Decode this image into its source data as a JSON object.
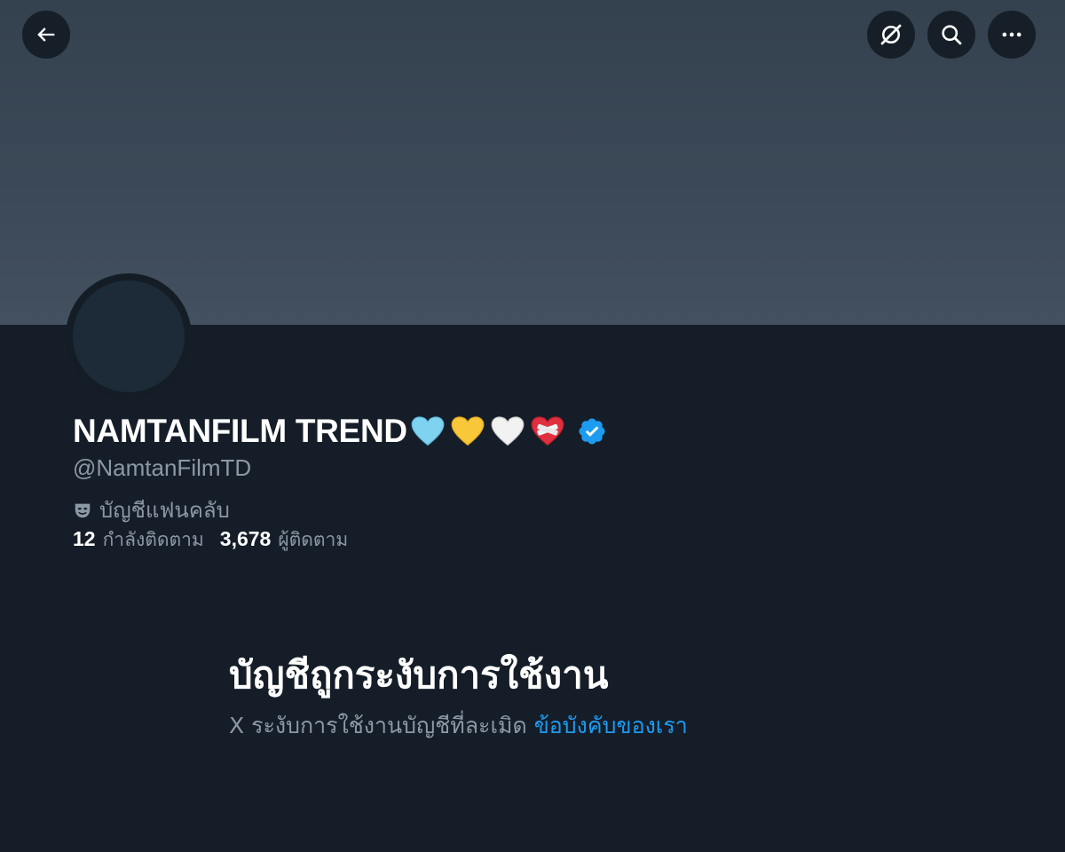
{
  "header": {
    "back_icon": "arrow-left-icon",
    "grok_icon": "grok-icon",
    "search_icon": "search-icon",
    "more_icon": "more-horizontal-icon"
  },
  "profile": {
    "display_name": "NAMTANFILM TREND",
    "name_emojis": [
      "light-blue-heart",
      "yellow-heart",
      "white-heart",
      "mending-heart"
    ],
    "verified_icon": "verified-badge-icon",
    "verified_color": "#1d9bf0",
    "handle": "@NamtanFilmTD",
    "category_icon": "parody-mask-icon",
    "category_label": "บัญชีแฟนคลับ",
    "following_count": "12",
    "following_label": "กำลังติดตาม",
    "followers_count": "3,678",
    "followers_label": "ผู้ติดตาม"
  },
  "suspension": {
    "title": "บัญชีถูกระงับการใช้งาน",
    "message": "X ระงับการใช้งานบัญชีที่ละเมิด",
    "link_text": "ข้อบังคับของเรา",
    "link_color": "#1d9bf0"
  },
  "colors": {
    "background": "#151d28",
    "banner": "#3c4958",
    "secondary_text": "#8b98a5",
    "accent": "#1d9bf0"
  }
}
